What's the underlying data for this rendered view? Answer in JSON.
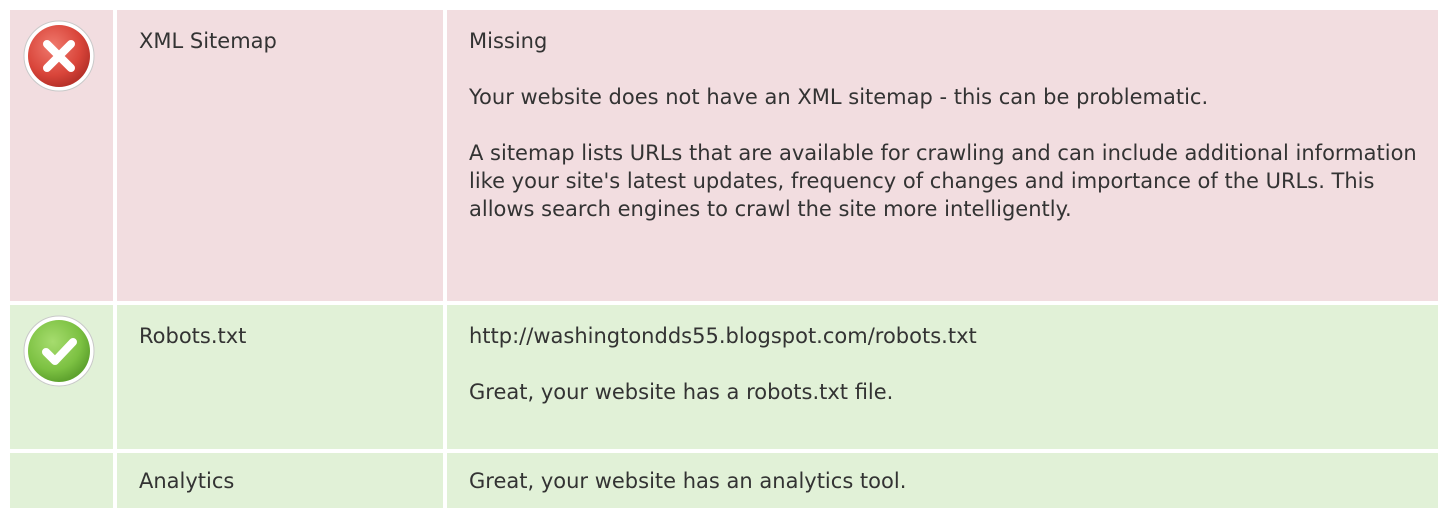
{
  "rows": [
    {
      "status": "error",
      "status_icon": "error-x-icon",
      "label": "XML Sitemap",
      "paragraphs": [
        "Missing",
        "Your website does not have an XML sitemap - this can be problematic.",
        "A sitemap lists URLs that are available for crawling and can include additional information like your site's latest updates, frequency of changes and importance of the URLs. This allows search engines to crawl the site more intelligently."
      ]
    },
    {
      "status": "ok",
      "status_icon": "success-check-icon",
      "label": "Robots.txt",
      "paragraphs": [
        "http://washingtondds55.blogspot.com/robots.txt",
        "Great, your website has a robots.txt file."
      ]
    },
    {
      "status": "ok",
      "status_icon": "",
      "label": "Analytics",
      "paragraphs": [
        "Great, your website has an analytics tool."
      ]
    }
  ],
  "colors": {
    "error_row_bg": "#f2dde0",
    "ok_row_bg": "#e1f1d7",
    "error_icon": "#d9453a",
    "ok_icon": "#7cc142"
  }
}
